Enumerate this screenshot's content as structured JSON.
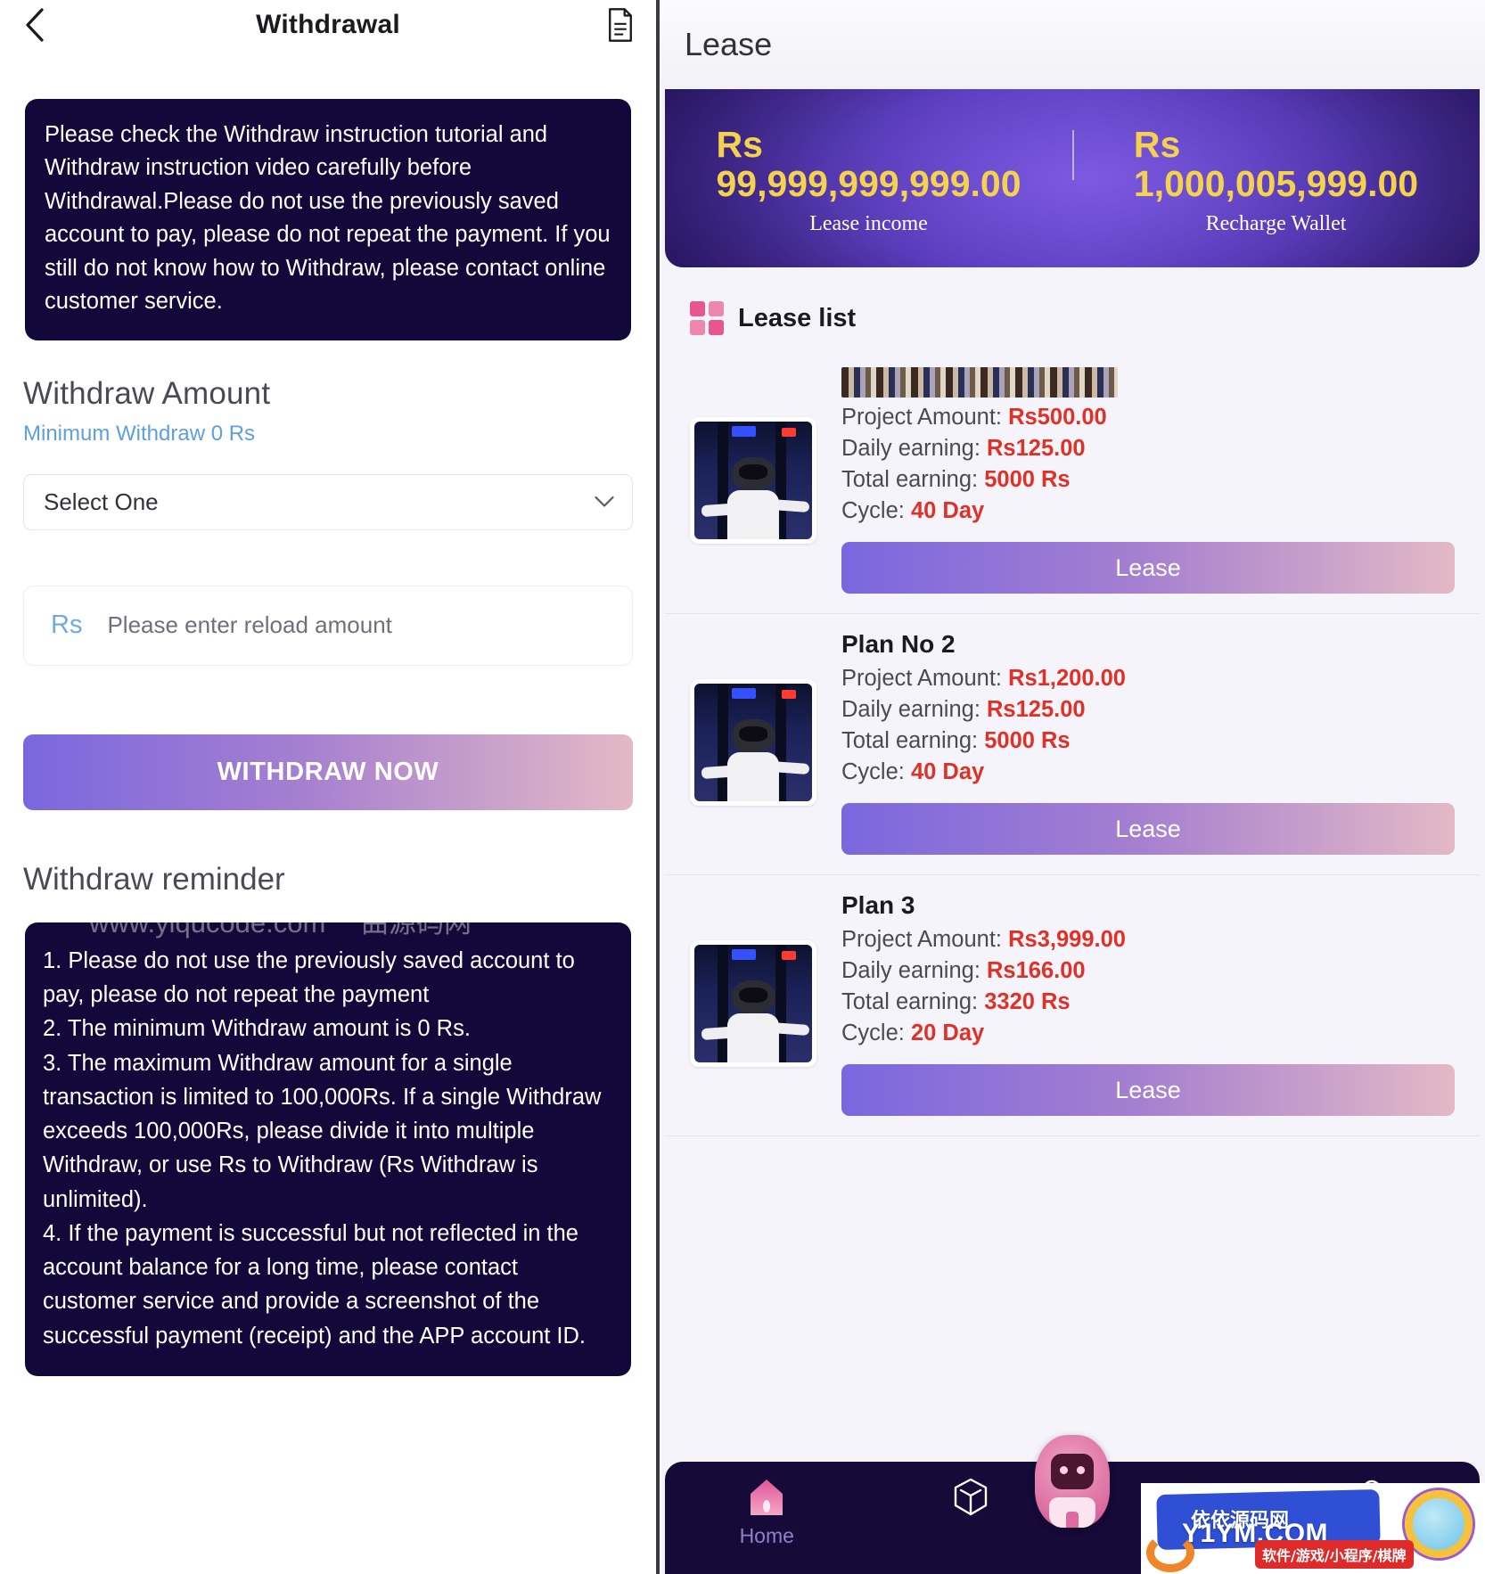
{
  "left": {
    "header": {
      "title": "Withdrawal",
      "back_icon": "chevron-left-icon",
      "doc_icon": "document-icon"
    },
    "notice": "Please check the Withdraw instruction tutorial and Withdraw instruction video carefully before Withdrawal.Please do not use the previously saved account to pay, please do not repeat the payment. If you still do not know how to Withdraw, please contact online customer service.",
    "amount_section": {
      "title": "Withdraw Amount",
      "min_note": "Minimum Withdraw 0 Rs",
      "select_value": "Select One",
      "currency_prefix": "Rs",
      "amount_placeholder": "Please enter reload amount",
      "amount_value": "",
      "submit_label": "WITHDRAW NOW"
    },
    "reminder": {
      "title": "Withdraw reminder",
      "watermark": "www.yiqucode.com 一曲源码网",
      "items": [
        "1. Please do not use the previously saved account to pay, please do not repeat the payment",
        "2. The minimum Withdraw amount is 0 Rs.",
        "3. The maximum Withdraw amount for a single transaction is limited to 100,000Rs. If a single Withdraw exceeds 100,000Rs, please divide it into multiple Withdraw, or use Rs to Withdraw (Rs Withdraw is unlimited).",
        "4. If the payment is successful but not reflected in the account balance for a long time, please contact customer service and provide a screenshot of the successful payment (receipt) and the APP account ID."
      ]
    }
  },
  "right": {
    "header": {
      "title": "Lease"
    },
    "balance": {
      "currency": "Rs",
      "left_amount": "99,999,999,999.00",
      "left_label": "Lease income",
      "right_amount": "1,000,005,999.00",
      "right_label": "Recharge Wallet"
    },
    "lease_list": {
      "icon": "grid-icon",
      "title": "Lease list",
      "labels": {
        "project_amount": "Project Amount:",
        "daily_earning": "Daily earning:",
        "total_earning": "Total earning:",
        "cycle": "Cycle:"
      },
      "items": [
        {
          "name": "",
          "name_redacted": true,
          "project_amount": "Rs500.00",
          "daily_earning": "Rs125.00",
          "total_earning": "5000 Rs",
          "cycle": "40 Day",
          "button_label": "Lease"
        },
        {
          "name": "Plan No 2",
          "name_redacted": false,
          "project_amount": "Rs1,200.00",
          "daily_earning": "Rs125.00",
          "total_earning": "5000 Rs",
          "cycle": "40 Day",
          "button_label": "Lease"
        },
        {
          "name": "Plan 3",
          "name_redacted": false,
          "project_amount": "Rs3,999.00",
          "daily_earning": "Rs166.00",
          "total_earning": "3320 Rs",
          "cycle": "20 Day",
          "button_label": "Lease"
        }
      ]
    },
    "bottom_nav": {
      "items": [
        {
          "icon": "home-icon",
          "label": "Home"
        },
        {
          "icon": "cube-icon",
          "label": ""
        },
        {
          "icon": "users-icon",
          "label": ""
        }
      ],
      "mascot_icon": "robot-mascot-icon"
    },
    "watermark_badge": {
      "cn_text": "依依源码网",
      "en_text": "Y1YM.COM",
      "tag_text": "软件/游戏/小程序/棋牌"
    }
  },
  "colors": {
    "dark_navy": "#13083a",
    "accent_purple": "#7a67de",
    "accent_pink": "#e3b9c6",
    "value_red": "#e03127",
    "gold": "#f5d24e",
    "link_blue": "#5e9fe0"
  }
}
